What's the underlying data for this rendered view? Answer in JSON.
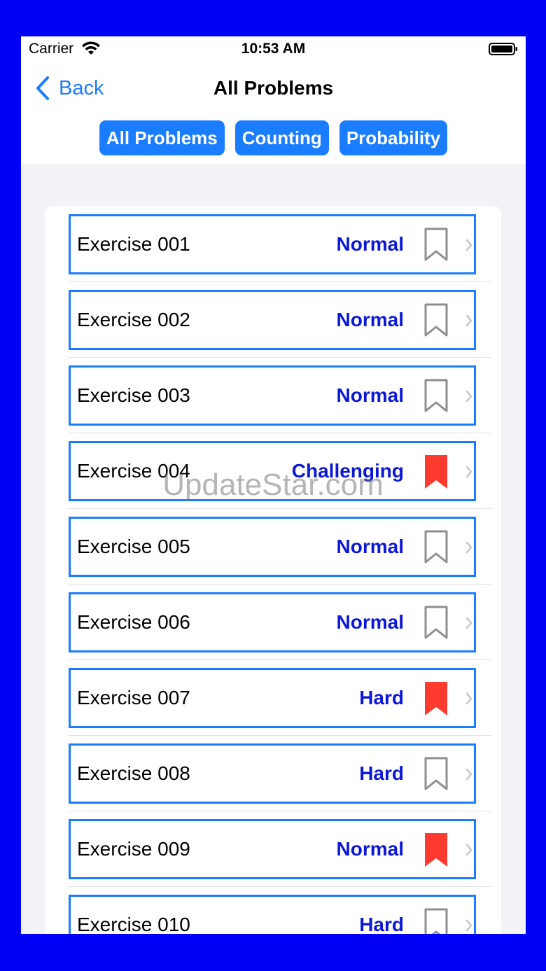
{
  "status_bar": {
    "carrier": "Carrier",
    "time": "10:53 AM"
  },
  "nav": {
    "back_label": "Back",
    "title": "All Problems"
  },
  "segments": [
    "All Problems",
    "Counting",
    "Probability"
  ],
  "exercises": [
    {
      "title": "Exercise 001",
      "difficulty": "Normal",
      "bookmarked": false
    },
    {
      "title": "Exercise 002",
      "difficulty": "Normal",
      "bookmarked": false
    },
    {
      "title": "Exercise 003",
      "difficulty": "Normal",
      "bookmarked": false
    },
    {
      "title": "Exercise 004",
      "difficulty": "Challenging",
      "bookmarked": true
    },
    {
      "title": "Exercise 005",
      "difficulty": "Normal",
      "bookmarked": false
    },
    {
      "title": "Exercise 006",
      "difficulty": "Normal",
      "bookmarked": false
    },
    {
      "title": "Exercise 007",
      "difficulty": "Hard",
      "bookmarked": true
    },
    {
      "title": "Exercise 008",
      "difficulty": "Hard",
      "bookmarked": false
    },
    {
      "title": "Exercise 009",
      "difficulty": "Normal",
      "bookmarked": true
    },
    {
      "title": "Exercise 010",
      "difficulty": "Hard",
      "bookmarked": false
    }
  ],
  "watermark": "UpdateStar.com",
  "colors": {
    "frame": "#0000f5",
    "accent": "#1a7cff",
    "difficulty_text": "#0d17d6",
    "bookmark_on": "#ff3b30",
    "bookmark_off": "#8e8e93"
  },
  "icons": {
    "back": "chevron-left-icon",
    "bookmark": "bookmark-icon",
    "disclosure": "chevron-right-icon",
    "wifi": "wifi-icon",
    "battery": "battery-icon"
  }
}
